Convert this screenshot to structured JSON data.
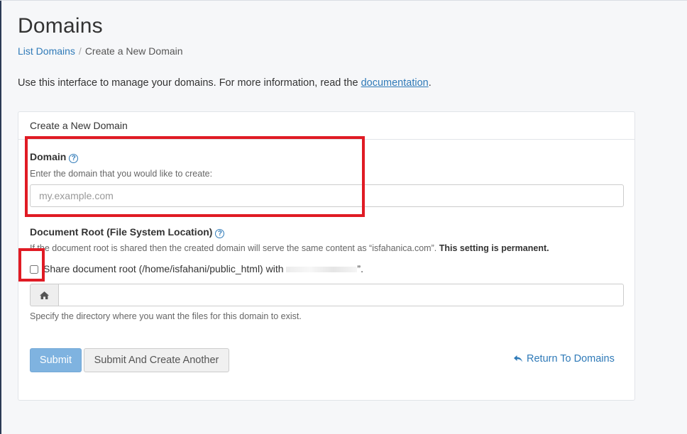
{
  "header": {
    "title": "Domains"
  },
  "breadcrumb": {
    "items": [
      {
        "label": "List Domains"
      },
      {
        "label": "Create a New Domain"
      }
    ],
    "separator": "/"
  },
  "intro": {
    "text": "Use this interface to manage your domains. For more information, read the",
    "link_label": "documentation",
    "suffix": "."
  },
  "panel": {
    "heading": "Create a New Domain",
    "domain": {
      "label": "Domain",
      "hint": "Enter the domain that you would like to create:",
      "placeholder": "my.example.com",
      "value": ""
    },
    "docroot": {
      "label": "Document Root (File System Location)",
      "hint_prefix": "If the document root is shared then the created domain will serve the same content as “isfahanica.com”.",
      "hint_strong": "This setting is permanent.",
      "share_label": "Share document root (/home/isfahani/public_html) with",
      "share_label_suffix": "”.",
      "share_checked": false,
      "path_value": "",
      "path_hint": "Specify the directory where you want the files for this domain to exist."
    },
    "actions": {
      "submit": "Submit",
      "submit_another": "Submit And Create Another",
      "return": "Return To Domains"
    }
  },
  "colors": {
    "accent": "#2f7ab8",
    "highlight": "#e01b24",
    "primary_button": "#7fb3e0"
  },
  "icons": {
    "help": "question-circle-icon",
    "home": "home-icon",
    "return": "reply-arrow-icon"
  }
}
